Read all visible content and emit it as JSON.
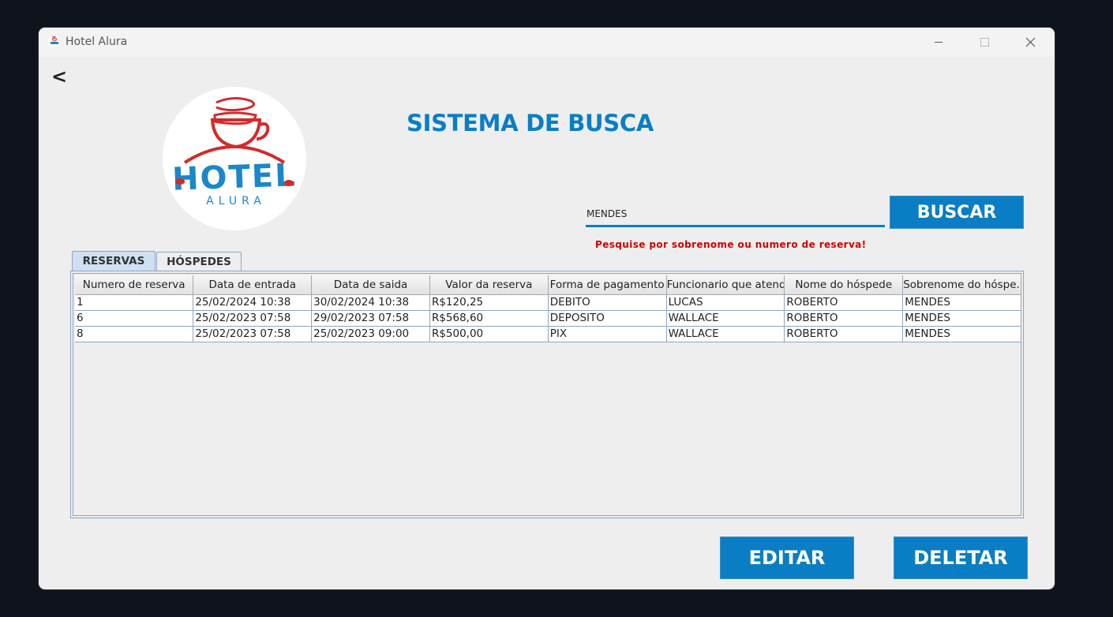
{
  "window": {
    "title": "Hotel Alura"
  },
  "back_label": "<",
  "logo": {
    "text_main": "HOTEL",
    "text_sub": "ALURA"
  },
  "heading": "SISTEMA DE BUSCA",
  "search": {
    "value": "MENDES",
    "button_label": "BUSCAR",
    "hint": "Pesquise por sobrenome ou numero de reserva!"
  },
  "tabs": [
    {
      "label": "RESERVAS",
      "active": true
    },
    {
      "label": "HÓSPEDES",
      "active": false
    }
  ],
  "table": {
    "columns": [
      "Numero de reserva",
      "Data de entrada",
      "Data de saida",
      "Valor da reserva",
      "Forma de pagamento",
      "Funcionario que atend...",
      "Nome do hóspede",
      "Sobrenome do hóspe..."
    ],
    "rows": [
      [
        "1",
        "25/02/2024 10:38",
        "30/02/2024 10:38",
        "R$120,25",
        "DEBITO",
        "LUCAS",
        "ROBERTO",
        "MENDES"
      ],
      [
        "6",
        "25/02/2023 07:58",
        "29/02/2023 07:58",
        "R$568,60",
        "DEPOSITO",
        "WALLACE",
        "ROBERTO",
        "MENDES"
      ],
      [
        "8",
        "25/02/2023 07:58",
        "25/02/2023 09:00",
        "R$500,00",
        "PIX",
        "WALLACE",
        "ROBERTO",
        "MENDES"
      ]
    ]
  },
  "actions": {
    "edit_label": "EDITAR",
    "delete_label": "DELETAR"
  },
  "colors": {
    "accent": "#0a7ec4",
    "hint": "#d10000",
    "logo_red": "#d42a2a",
    "logo_blue": "#1a88c8"
  }
}
